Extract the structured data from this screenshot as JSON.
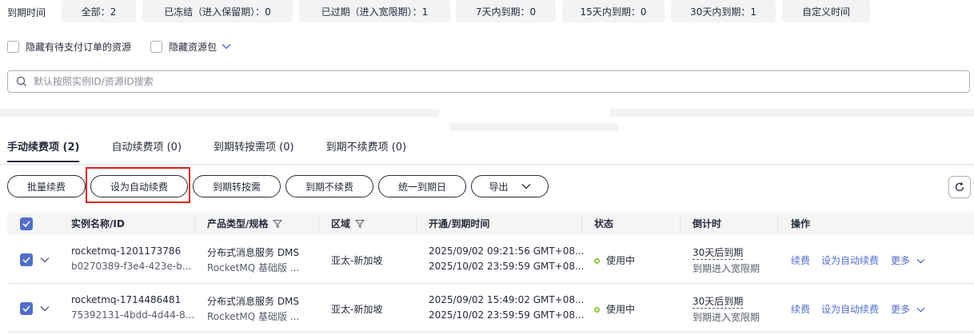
{
  "filters": {
    "label": "到期时间",
    "chips": [
      {
        "label": "全部：2"
      },
      {
        "label": "已冻结（进入保留期）：0"
      },
      {
        "label": "已过期（进入宽限期）：1"
      },
      {
        "label": "7天内到期：0"
      },
      {
        "label": "15天内到期：0"
      },
      {
        "label": "30天内到期：1"
      },
      {
        "label": "自定义时间"
      }
    ]
  },
  "options": {
    "hide_unpaid": "隐藏有待支付订单的资源",
    "hide_package": "隐藏资源包"
  },
  "search": {
    "placeholder": "默认按照实例ID/资源ID搜索"
  },
  "tabs": [
    {
      "label": "手动续费项 (2)"
    },
    {
      "label": "自动续费项 (0)"
    },
    {
      "label": "到期转按需项 (0)"
    },
    {
      "label": "到期不续费项 (0)"
    }
  ],
  "toolbar": {
    "batch_renew": "批量续费",
    "set_auto_renew": "设为自动续费",
    "to_on_demand": "到期转按需",
    "no_renew": "到期不续费",
    "unify_expiry": "统一到期日",
    "export": "导出"
  },
  "table": {
    "headers": {
      "name": "实例名称/ID",
      "product": "产品类型/规格",
      "region": "区域",
      "time": "开通/到期时间",
      "status": "状态",
      "countdown": "倒计时",
      "actions": "操作"
    },
    "rows": [
      {
        "name": "rocketmq-1201173786",
        "id": "b0270389-f3e4-423e-b...",
        "product": "分布式消息服务 DMS",
        "spec": "RocketMQ 基础版 ...",
        "region": "亚太-新加坡",
        "open_time": "2025/09/02 09:21:56 GMT+08...",
        "expire_time": "2025/10/02 23:59:59 GMT+08...",
        "status": "使用中",
        "countdown": "30天后到期",
        "countdown_note": "到期进入宽限期",
        "action_renew": "续费",
        "action_auto": "设为自动续费",
        "action_more": "更多"
      },
      {
        "name": "rocketmq-1714486481",
        "id": "75392131-4bdd-4d44-8...",
        "product": "分布式消息服务 DMS",
        "spec": "RocketMQ 基础版 ...",
        "region": "亚太-新加坡",
        "open_time": "2025/09/02 15:49:02 GMT+08...",
        "expire_time": "2025/10/02 23:59:59 GMT+08...",
        "status": "使用中",
        "countdown": "30天后到期",
        "countdown_note": "到期进入宽限期",
        "action_renew": "续费",
        "action_auto": "设为自动续费",
        "action_more": "更多"
      }
    ]
  },
  "colors": {
    "accent": "#526ecc",
    "highlight": "#e02020",
    "status_ok": "#8ec63f"
  }
}
